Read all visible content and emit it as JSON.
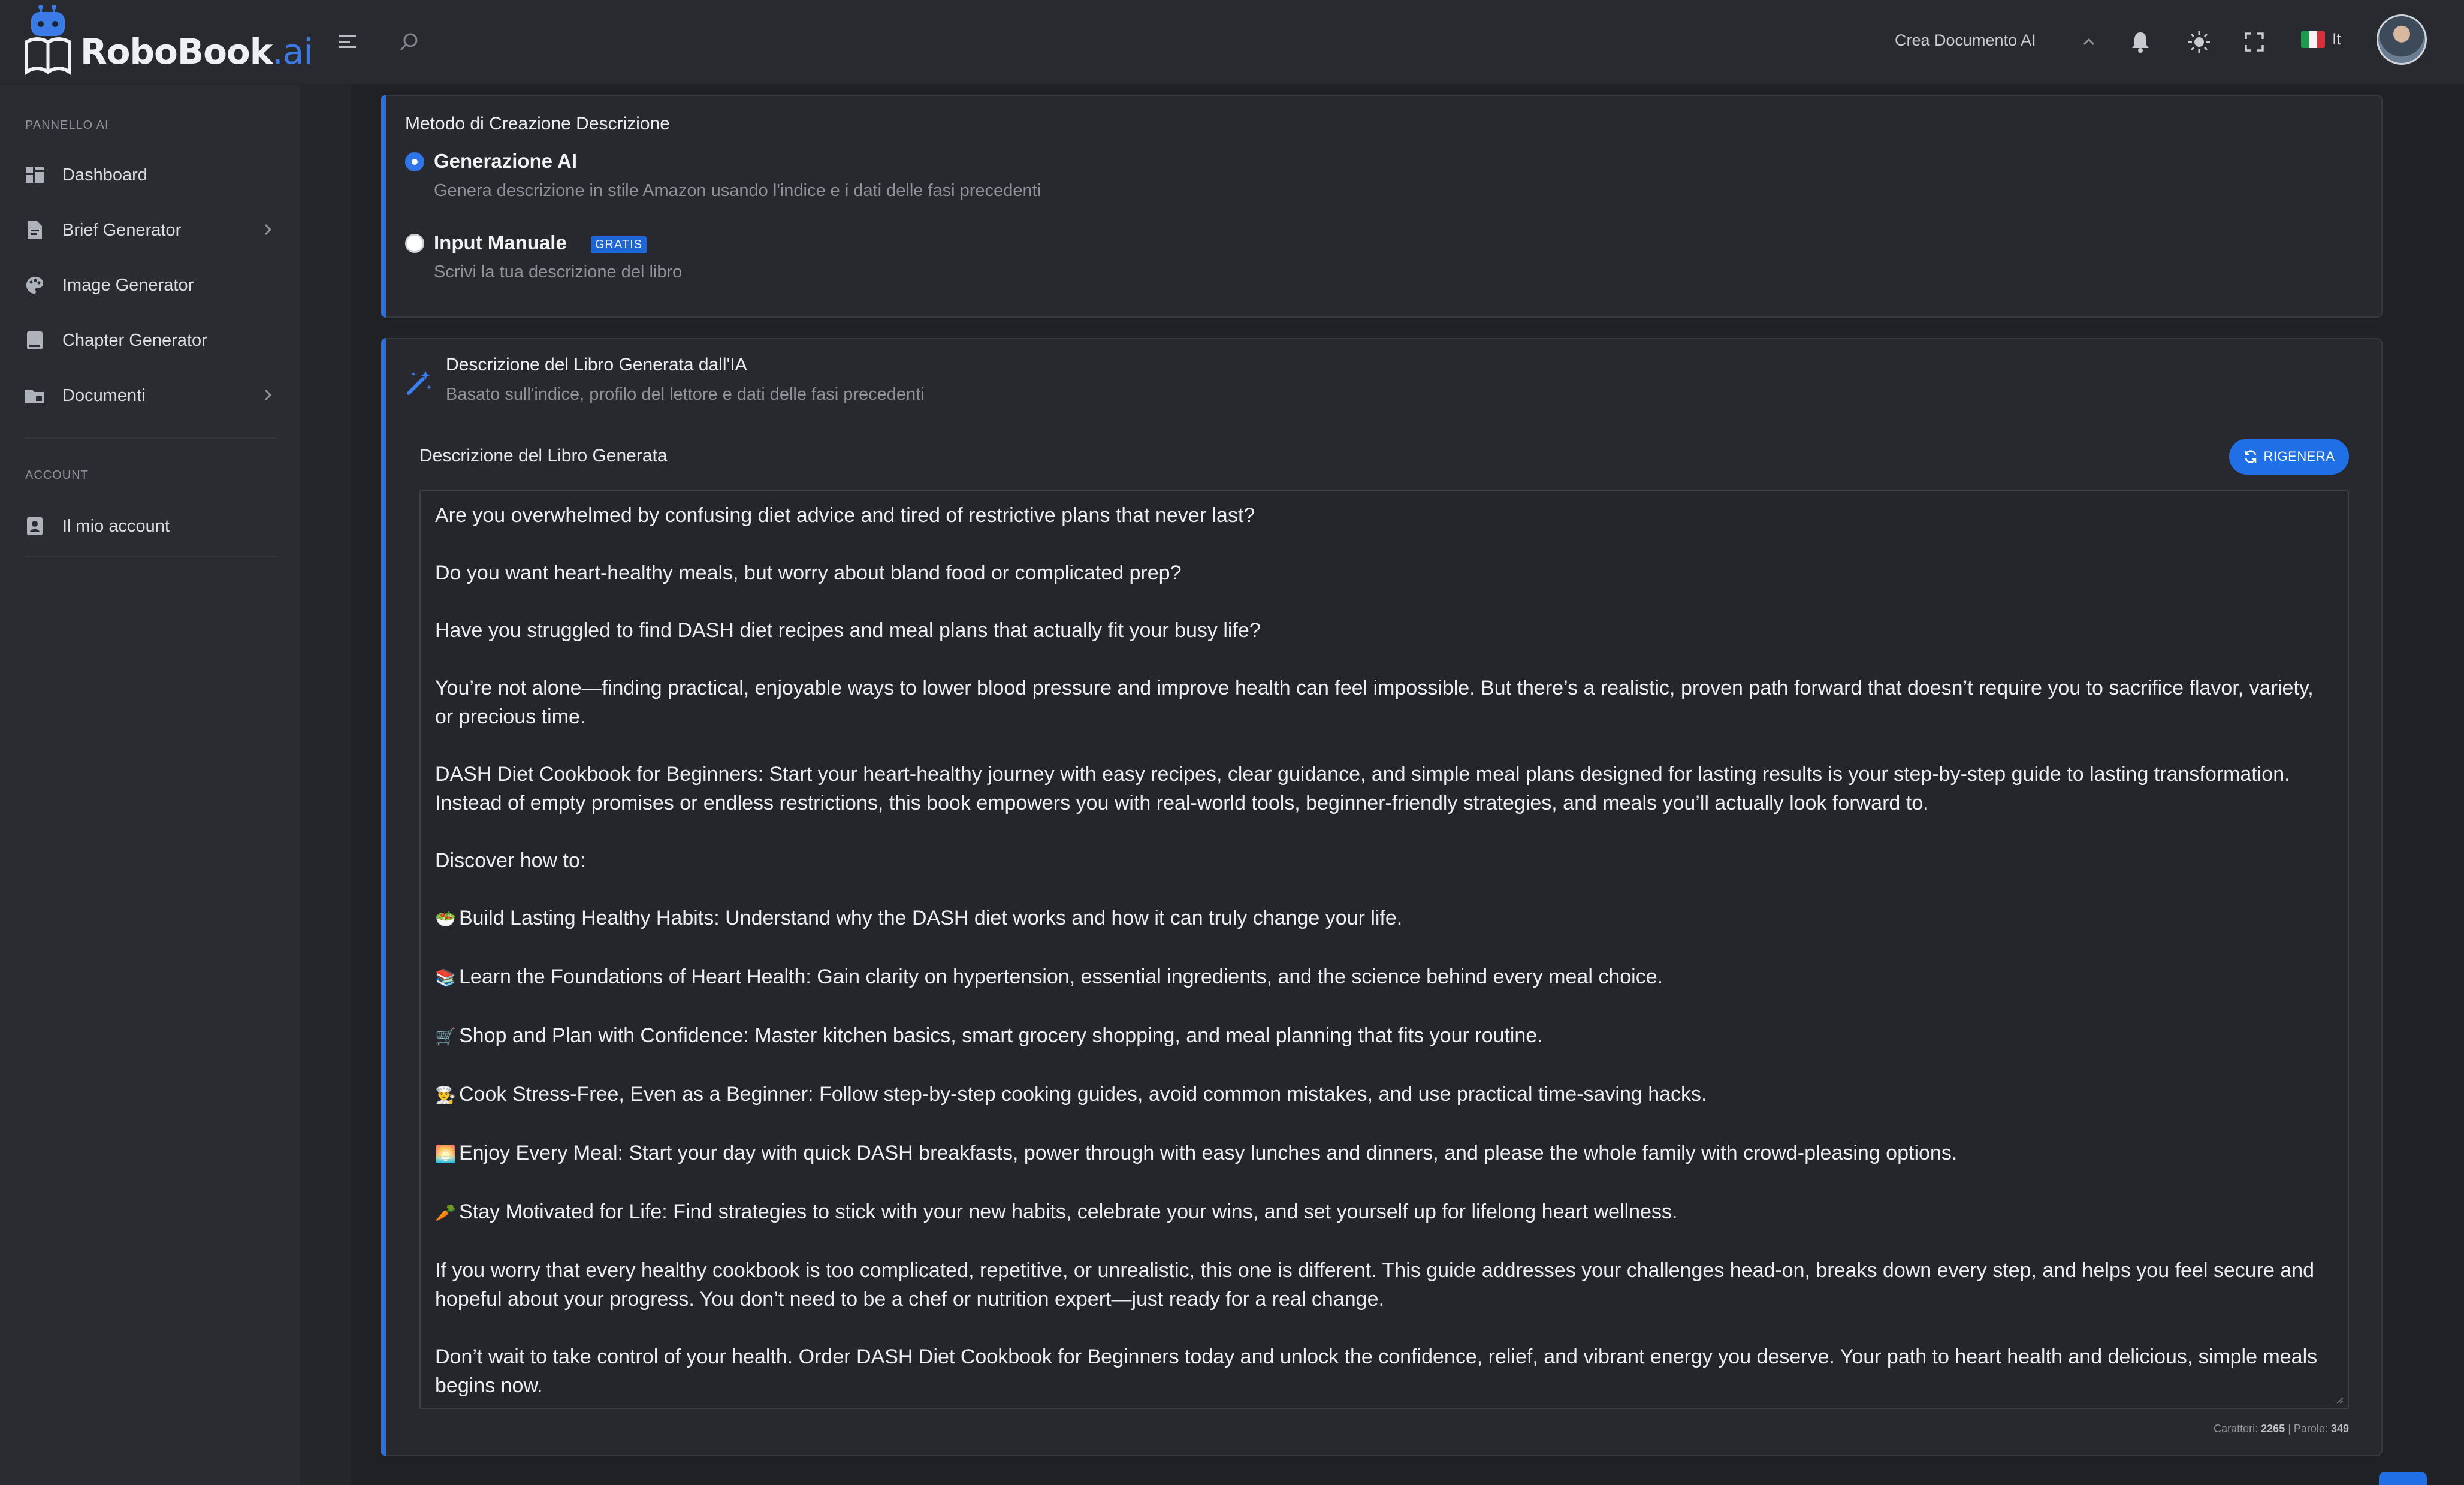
{
  "brand": {
    "name": "RoboBook",
    "suffix": ".ai"
  },
  "topbar": {
    "menu_icon": "hamburger-icon",
    "search_icon": "search-icon",
    "crea_label": "Crea Documento AI",
    "language": "It",
    "icons": [
      "bell-icon",
      "sun-icon",
      "fullscreen-icon"
    ]
  },
  "sidebar": {
    "section_ai": "PANNELLO AI",
    "items": [
      {
        "label": "Dashboard",
        "icon": "dashboard-icon"
      },
      {
        "label": "Brief Generator",
        "icon": "file-icon",
        "has_submenu": true
      },
      {
        "label": "Image Generator",
        "icon": "palette-icon"
      },
      {
        "label": "Chapter Generator",
        "icon": "book-icon"
      },
      {
        "label": "Documenti",
        "icon": "folder-icon",
        "has_submenu": true
      }
    ],
    "section_account": "ACCOUNT",
    "account_items": [
      {
        "label": "Il mio account",
        "icon": "contact-icon"
      }
    ]
  },
  "method": {
    "title": "Metodo di Creazione Descrizione",
    "options": [
      {
        "label": "Generazione AI",
        "desc": "Genera descrizione in stile Amazon usando l'indice e i dati delle fasi precedenti",
        "selected": true
      },
      {
        "label": "Input Manuale",
        "badge": "GRATIS",
        "desc": "Scrivi la tua descrizione del libro",
        "selected": false
      }
    ]
  },
  "generated": {
    "title": "Descrizione del Libro Generata dall'IA",
    "subtitle": "Basato sull'indice, profilo del lettore e dati delle fasi precedenti",
    "field_label": "Descrizione del Libro Generata",
    "regen_label": "RIGENERA",
    "paragraphs": [
      "Are you overwhelmed by confusing diet advice and tired of restrictive plans that never last?",
      "Do you want heart-healthy meals, but worry about bland food or complicated prep?",
      "Have you struggled to find DASH diet recipes and meal plans that actually fit your busy life?",
      "You’re not alone—finding practical, enjoyable ways to lower blood pressure and improve health can feel impossible. But there’s a realistic, proven path forward that doesn’t require you to sacrifice flavor, variety, or precious time.",
      "DASH Diet Cookbook for Beginners: Start your heart-healthy journey with easy recipes, clear guidance, and simple meal plans designed for lasting results is your step-by-step guide to lasting transformation. Instead of empty promises or endless restrictions, this book empowers you with real-world tools, beginner-friendly strategies, and meals you’ll actually look forward to.",
      "Discover how to:"
    ],
    "bullets": [
      {
        "emoji": "🥗",
        "text": "Build Lasting Healthy Habits: Understand why the DASH diet works and how it can truly change your life."
      },
      {
        "emoji": "📚",
        "text": "Learn the Foundations of Heart Health: Gain clarity on hypertension, essential ingredients, and the science behind every meal choice."
      },
      {
        "emoji": "🛒",
        "text": "Shop and Plan with Confidence: Master kitchen basics, smart grocery shopping, and meal planning that fits your routine."
      },
      {
        "emoji": "👨‍🍳",
        "text": "Cook Stress-Free, Even as a Beginner: Follow step-by-step cooking guides, avoid common mistakes, and use practical time-saving hacks."
      },
      {
        "emoji": "🌅",
        "text": "Enjoy Every Meal: Start your day with quick DASH breakfasts, power through with easy lunches and dinners, and please the whole family with crowd-pleasing options."
      },
      {
        "emoji": "🥕",
        "text": "Stay Motivated for Life: Find strategies to stick with your new habits, celebrate your wins, and set yourself up for lifelong heart wellness."
      }
    ],
    "closing": [
      "If you worry that every healthy cookbook is too complicated, repetitive, or unrealistic, this one is different. This guide addresses your challenges head-on, breaks down every step, and helps you feel secure and hopeful about your progress. You don’t need to be a chef or nutrition expert—just ready for a real change.",
      "Don’t wait to take control of your health. Order DASH Diet Cookbook for Beginners today and unlock the confidence, relief, and vibrant energy you deserve. Your path to heart health and delicious, simple meals begins now."
    ],
    "counter": {
      "chars_label": "Caratteri:",
      "chars": "2265",
      "sep": " | ",
      "words_label": "Parole:",
      "words": "349"
    }
  },
  "colors": {
    "accent": "#2f6fe0",
    "background": "#1f2125",
    "card": "#27292e"
  }
}
